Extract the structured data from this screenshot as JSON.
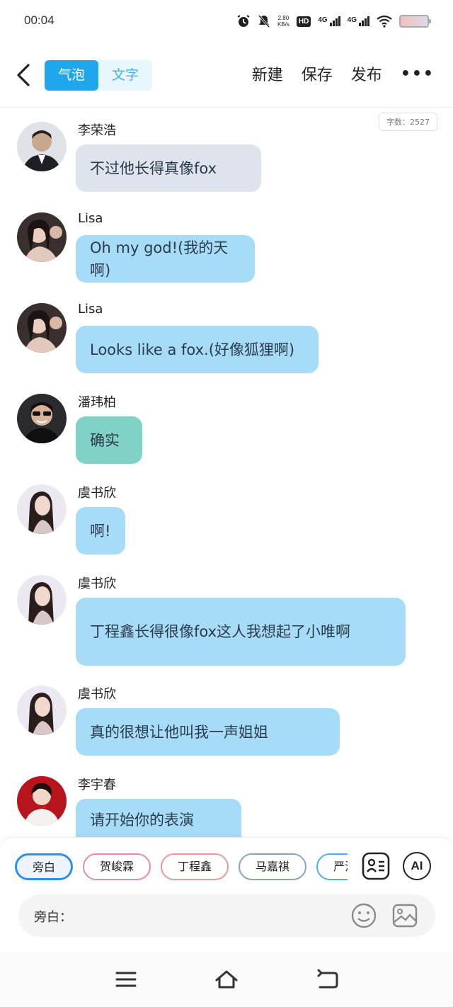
{
  "status_bar": {
    "time": "00:04",
    "net_speed_value": "2.80",
    "net_speed_unit": "KB/s",
    "hd_label": "HD",
    "sim1_label": "4G",
    "sim2_label": "4G"
  },
  "header": {
    "tabs": [
      {
        "label": "气泡",
        "active": true
      },
      {
        "label": "文字",
        "active": false
      }
    ],
    "actions": {
      "new": "新建",
      "save": "保存",
      "publish": "发布",
      "more": "•••"
    }
  },
  "word_count": "字数：2527",
  "messages": [
    {
      "name": "李荣浩",
      "text": "不过他长得真像fox",
      "style": "gray"
    },
    {
      "name": "Lisa",
      "text": "Oh my god!(我的天啊)",
      "style": "blue"
    },
    {
      "name": "Lisa",
      "text": "Looks like a fox.(好像狐狸啊)",
      "style": "blue"
    },
    {
      "name": "潘玮柏",
      "text": "确实",
      "style": "teal"
    },
    {
      "name": "虞书欣",
      "text": "啊!",
      "style": "blue"
    },
    {
      "name": "虞书欣",
      "text": "丁程鑫长得很像fox这人我想起了小唯啊",
      "style": "blue"
    },
    {
      "name": "虞书欣",
      "text": "真的很想让他叫我一声姐姐",
      "style": "blue"
    },
    {
      "name": "李宇春",
      "text": "请开始你的表演",
      "style": "blue"
    }
  ],
  "composer": {
    "roles": [
      "旁白",
      "贺峻霖",
      "丁程鑫",
      "马嘉祺",
      "严浩"
    ],
    "ai_label": "AI",
    "input_label": "旁白：",
    "input_value": "",
    "input_placeholder": ""
  },
  "colors": {
    "accent": "#1fa7ee",
    "bubble_gray": "#dfe4ec",
    "bubble_blue": "#a6dcf8",
    "bubble_teal": "#7fd2c5"
  }
}
